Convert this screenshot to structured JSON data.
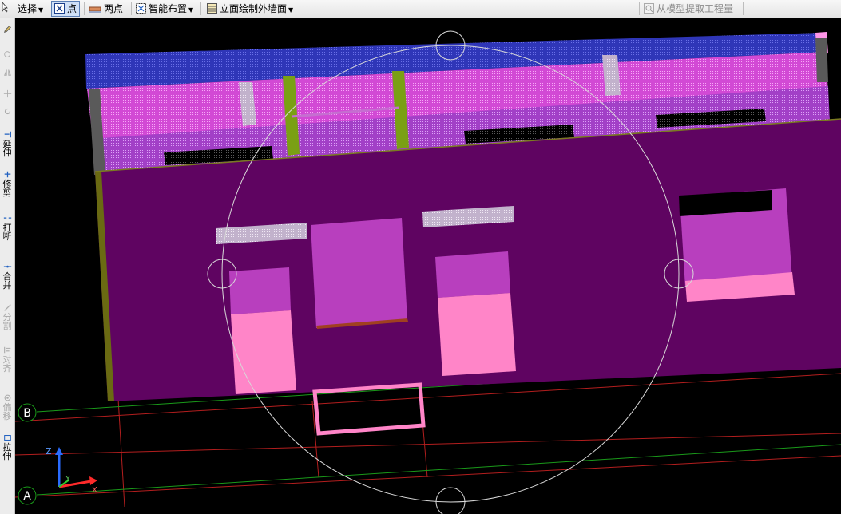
{
  "toolbar": {
    "select_label": "选择",
    "point_label": "点",
    "two_point_label": "两点",
    "smart_layout_label": "智能布置",
    "elevation_wall_label": "立面绘制外墙面",
    "extract_qty_label": "从模型提取工程量"
  },
  "sidebar": {
    "extend_label": "延伸",
    "trim_label": "修剪",
    "break_label": "打断",
    "merge_label": "合并",
    "split_label": "分割",
    "align_label": "对齐",
    "offset_label": "偏移",
    "stretch_label": "拉伸"
  },
  "viewport": {
    "axis_b_label": "B",
    "axis_a_label": "A",
    "ucs_x_label": "X",
    "ucs_y_label": "Y",
    "ucs_z_label": "Z"
  },
  "colors": {
    "wall_face": "#5f0461",
    "band_pink": "#d24ad5",
    "window_lower": "#ff85c8",
    "window_upper": "#b83fbe",
    "top_band": "#3238c4",
    "grid_line": "#b31e1e",
    "axis_line": "#1a9a1a"
  }
}
